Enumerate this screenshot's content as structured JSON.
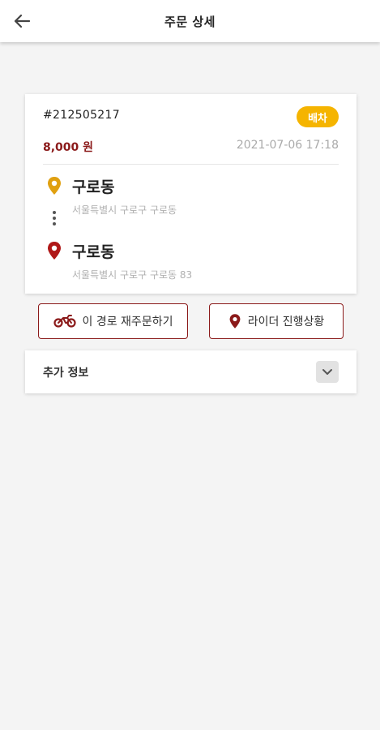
{
  "appbar": {
    "title": "주문 상세",
    "back_icon": "arrow-left-icon"
  },
  "order": {
    "number": "#212505217",
    "status": "배차",
    "price": "8,000 원",
    "datetime": "2021-07-06 17:18",
    "pickup": {
      "name": "구로동",
      "address": "서울특별시 구로구 구로동",
      "icon": "pickup-pin-icon"
    },
    "dropoff": {
      "name": "구로동",
      "address": "서울특별시 구로구 구로동 83",
      "icon": "dropoff-pin-icon"
    }
  },
  "actions": {
    "reorder_label": "이 경로 재주문하기",
    "reorder_icon": "motorcycle-icon",
    "progress_label": "라이더 진행상황",
    "progress_icon": "location-pin-icon"
  },
  "extra_info": {
    "label": "추가 정보",
    "icon": "chevron-down-icon"
  },
  "colors": {
    "accent": "#8b1a1a",
    "badge": "#f5b400",
    "pickup_pin": "#e0a010",
    "dropoff_pin": "#b01818",
    "background": "#f4f4f4"
  }
}
